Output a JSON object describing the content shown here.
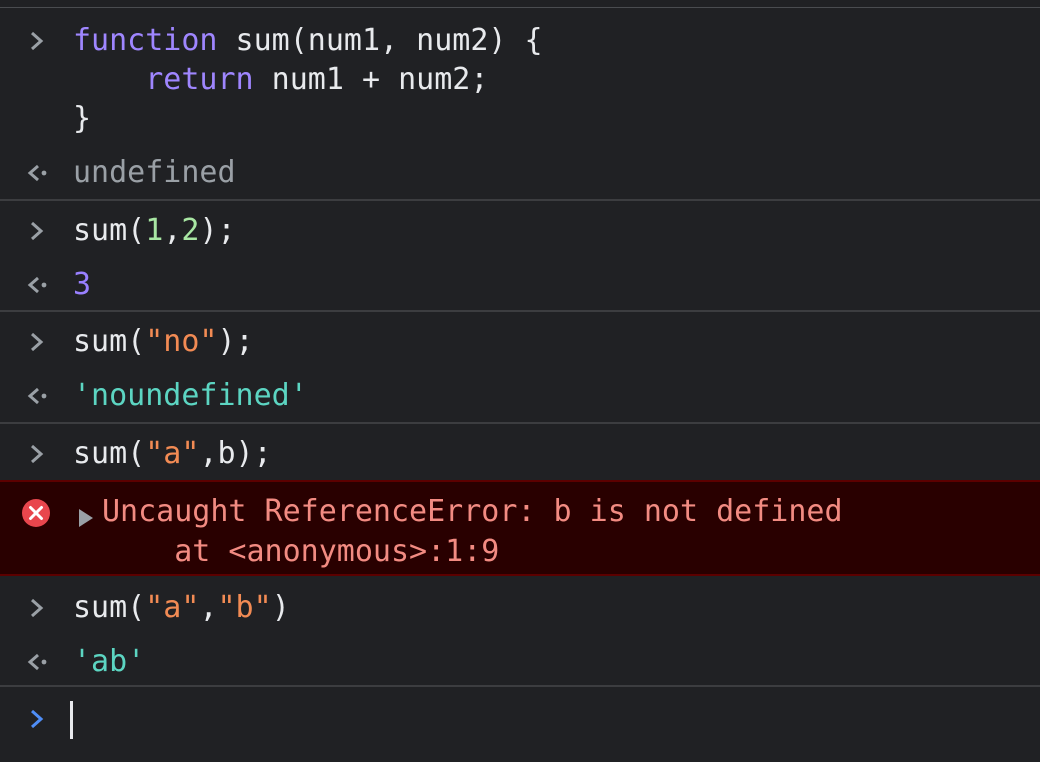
{
  "entries": [
    {
      "input_lines": [
        {
          "parts": [
            {
              "t": "function",
              "c": "kw"
            },
            {
              "t": " sum(num1, num2) {",
              "c": "plain"
            }
          ]
        },
        {
          "parts": [
            {
              "t": "    ",
              "c": "plain"
            },
            {
              "t": "return",
              "c": "kw"
            },
            {
              "t": " num1 + num2;",
              "c": "plain"
            }
          ]
        },
        {
          "parts": [
            {
              "t": "}",
              "c": "plain"
            }
          ]
        }
      ],
      "output": {
        "t": "undefined",
        "c": "muted"
      }
    },
    {
      "input_lines": [
        {
          "parts": [
            {
              "t": "sum(",
              "c": "plain"
            },
            {
              "t": "1",
              "c": "numarg"
            },
            {
              "t": ",",
              "c": "plain"
            },
            {
              "t": "2",
              "c": "numarg"
            },
            {
              "t": ");",
              "c": "plain"
            }
          ]
        }
      ],
      "output": {
        "t": "3",
        "c": "num"
      }
    },
    {
      "input_lines": [
        {
          "parts": [
            {
              "t": "sum(",
              "c": "plain"
            },
            {
              "t": "\"no\"",
              "c": "str"
            },
            {
              "t": ");",
              "c": "plain"
            }
          ]
        }
      ],
      "output": {
        "t": "'noundefined'",
        "c": "strval"
      }
    },
    {
      "input_lines": [
        {
          "parts": [
            {
              "t": "sum(",
              "c": "plain"
            },
            {
              "t": "\"a\"",
              "c": "str"
            },
            {
              "t": ",b);",
              "c": "plain"
            }
          ]
        }
      ]
    }
  ],
  "error": {
    "message": "Uncaught ReferenceError: b is not defined",
    "stack": "    at <anonymous>:1:9"
  },
  "last_entry": {
    "input_lines": [
      {
        "parts": [
          {
            "t": "sum(",
            "c": "plain"
          },
          {
            "t": "\"a\"",
            "c": "str"
          },
          {
            "t": ",",
            "c": "plain"
          },
          {
            "t": "\"b\"",
            "c": "str"
          },
          {
            "t": ")",
            "c": "plain"
          }
        ]
      }
    ],
    "output": {
      "t": "'ab'",
      "c": "strval"
    }
  },
  "colors": {
    "background": "#202124",
    "prompt_chevron": "#9aa0a6",
    "active_prompt_chevron": "#4f8ef7",
    "error_background": "#290000",
    "error_text": "#f28b82",
    "error_badge": "#e8464d"
  },
  "icons": {
    "input_prompt": "chevron-right-icon",
    "result": "return-arrow-icon",
    "error": "error-circle-icon",
    "expand": "triangle-right-icon"
  }
}
